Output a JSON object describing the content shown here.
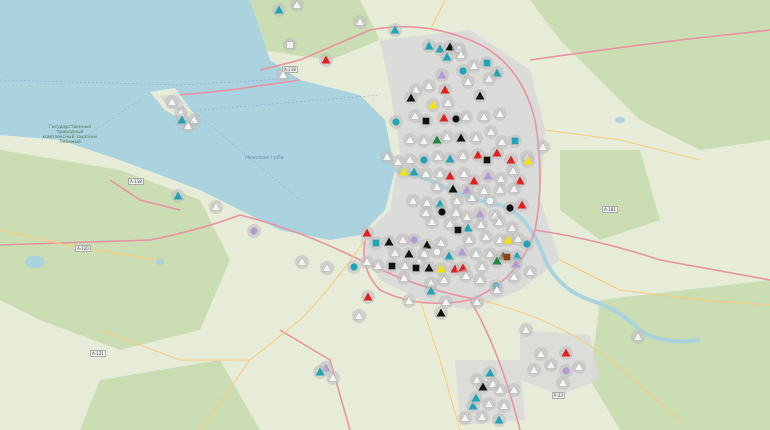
{
  "map": {
    "water_labels": [
      {
        "text": "Невская губа"
      }
    ],
    "park_labels": [
      {
        "text": "Государственный природный комплексный заказник Лебяжий"
      }
    ],
    "road_labels": [
      {
        "text": "А-118"
      },
      {
        "text": "А-118"
      },
      {
        "text": "А-121"
      },
      {
        "text": "А-120"
      },
      {
        "text": "Р-23"
      },
      {
        "text": "А-181"
      }
    ],
    "colors": {
      "water": "#aad3df",
      "land": "#e8eedc",
      "forest": "#c9dfae",
      "urban": "#dcdcdc",
      "road_major": "#e892a2",
      "road_minor": "#f9c97a",
      "marker_teal": "#1fa3b5",
      "marker_red": "#e02020",
      "marker_black": "#111111",
      "marker_white": "#f4f4f4",
      "marker_purple": "#b39ad1",
      "marker_yellow": "#f2e500",
      "marker_green": "#1f8a3c",
      "marker_brown": "#8b4513"
    },
    "marker_icons": [
      "teal-triangle-icon",
      "red-triangle-icon",
      "black-triangle-icon",
      "white-triangle-icon",
      "purple-triangle-icon",
      "yellow-triangle-icon",
      "green-triangle-icon",
      "black-circle-icon",
      "purple-circle-icon",
      "teal-circle-icon",
      "brown-square-icon"
    ]
  }
}
